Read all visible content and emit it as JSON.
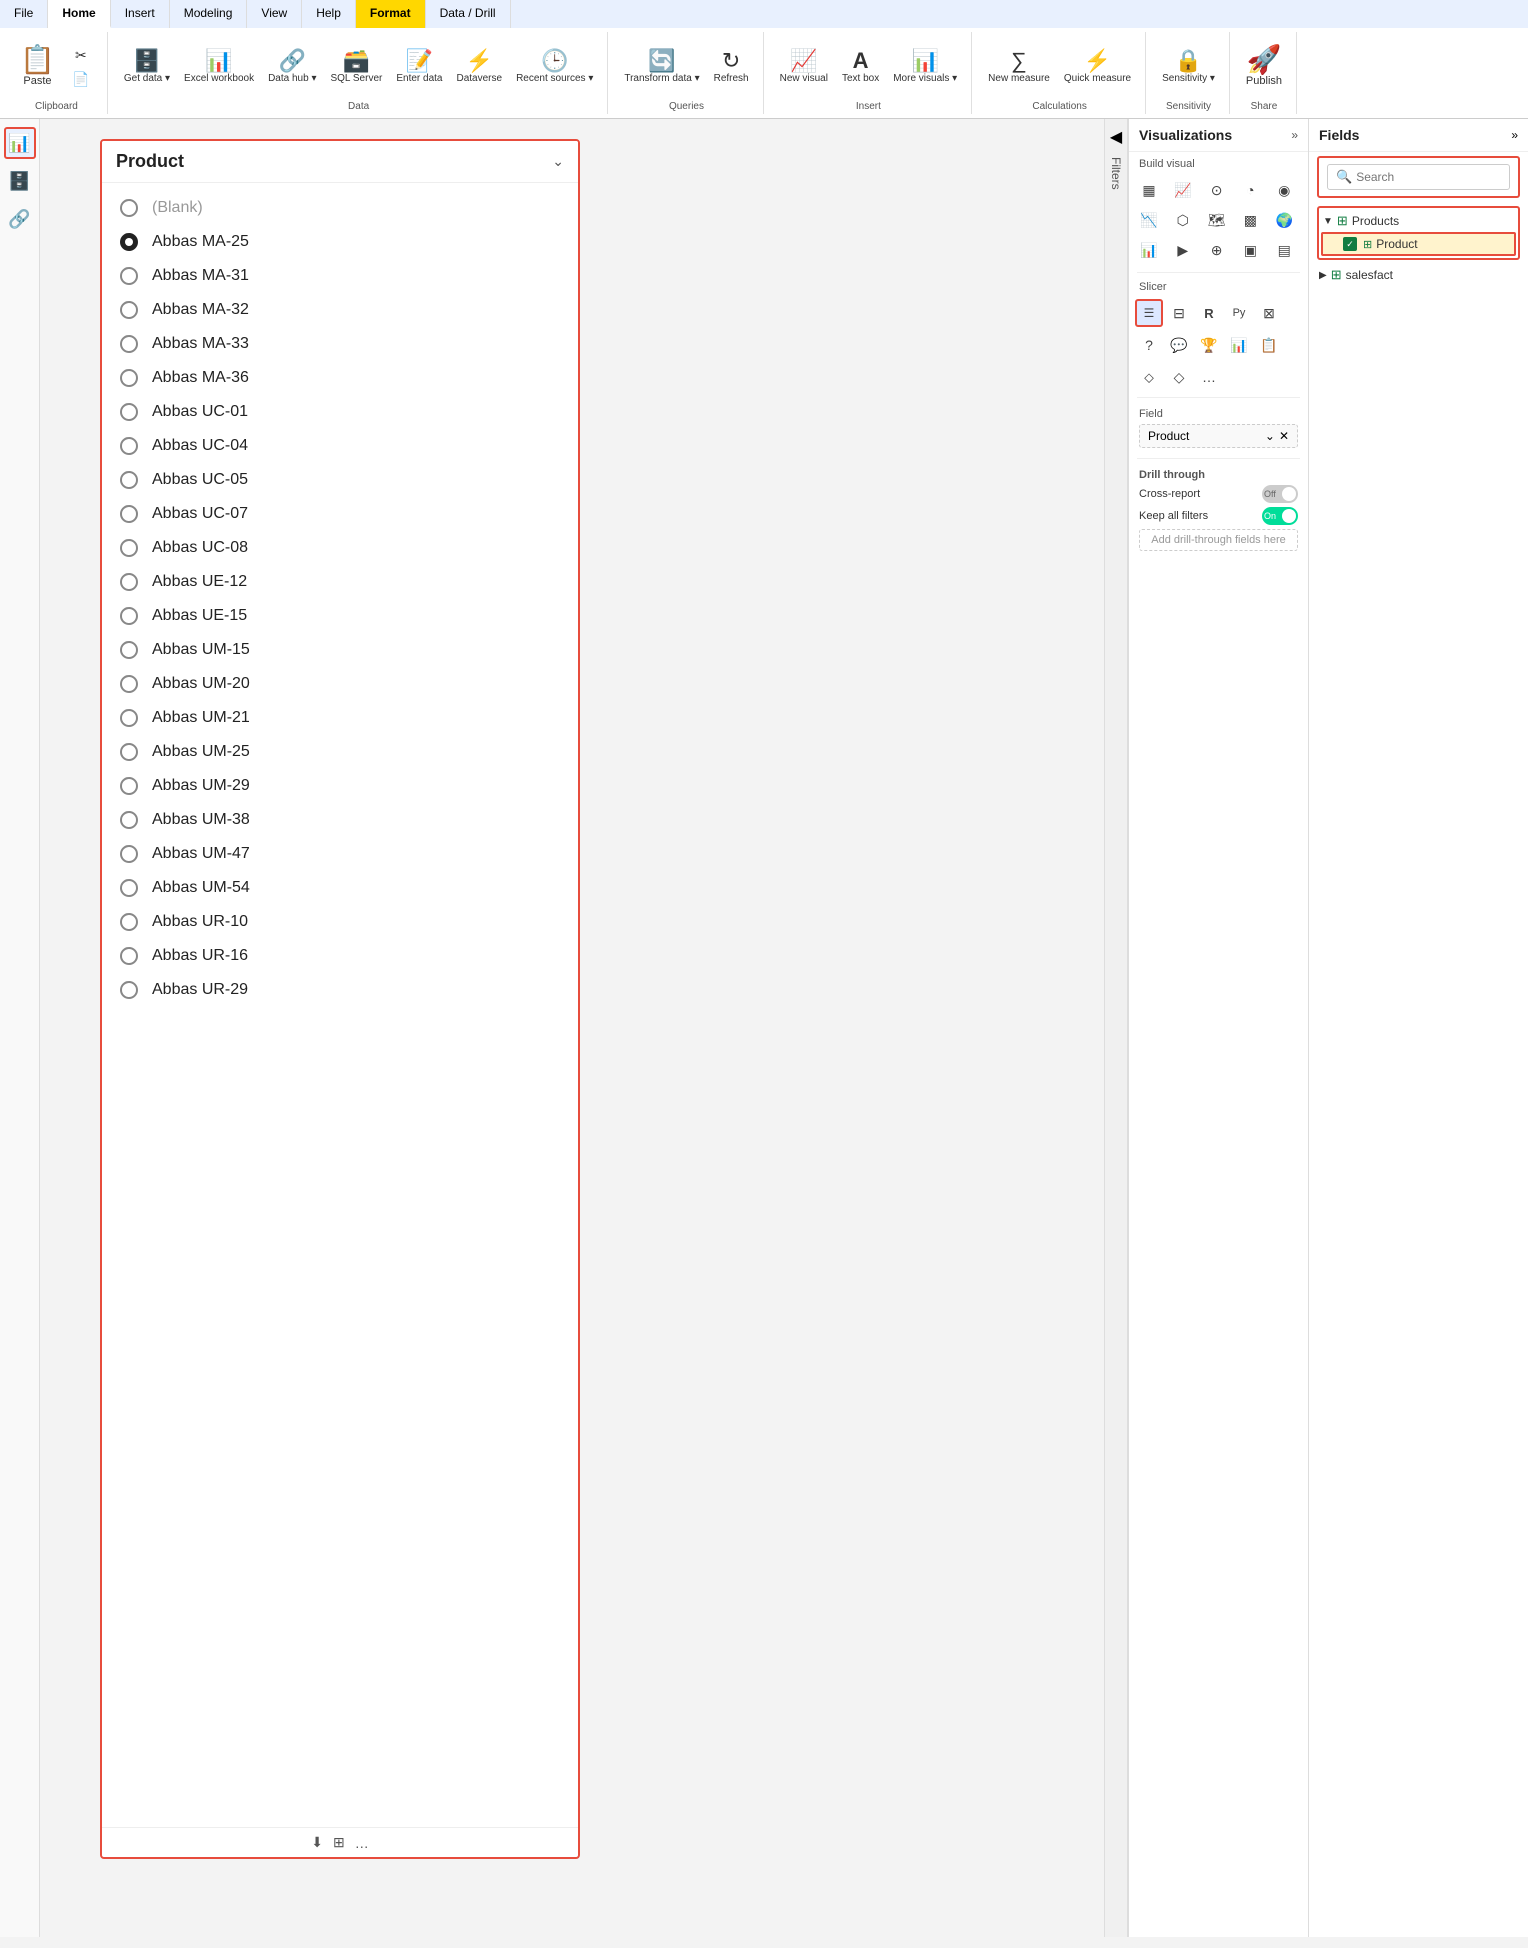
{
  "ribbon": {
    "tabs": [
      {
        "label": "File",
        "active": false
      },
      {
        "label": "Home",
        "active": true
      },
      {
        "label": "Insert",
        "active": false
      },
      {
        "label": "Modeling",
        "active": false
      },
      {
        "label": "View",
        "active": false
      },
      {
        "label": "Help",
        "active": false
      },
      {
        "label": "Format",
        "active": false,
        "highlight": true
      },
      {
        "label": "Data / Drill",
        "active": false
      }
    ],
    "groups": [
      {
        "name": "Clipboard",
        "buttons": [
          {
            "label": "Paste",
            "icon": "📋"
          },
          {
            "label": "",
            "icon": "✂️"
          },
          {
            "label": "",
            "icon": "📄"
          }
        ]
      },
      {
        "name": "Data",
        "buttons": [
          {
            "label": "Get data ▾",
            "icon": "🗄️"
          },
          {
            "label": "Excel workbook",
            "icon": "📊"
          },
          {
            "label": "Data hub ▾",
            "icon": "🔗"
          },
          {
            "label": "SQL Server",
            "icon": "🗃️"
          },
          {
            "label": "Enter data",
            "icon": "📝"
          },
          {
            "label": "Dataverse",
            "icon": "⚡"
          },
          {
            "label": "Recent sources ▾",
            "icon": "🕒"
          }
        ]
      },
      {
        "name": "Queries",
        "buttons": [
          {
            "label": "Transform data ▾",
            "icon": "🔄"
          },
          {
            "label": "Refresh",
            "icon": "↻"
          }
        ]
      },
      {
        "name": "Insert",
        "buttons": [
          {
            "label": "New visual",
            "icon": "📈"
          },
          {
            "label": "Text box",
            "icon": "A"
          },
          {
            "label": "More visuals ▾",
            "icon": "📊"
          }
        ]
      },
      {
        "name": "Calculations",
        "buttons": [
          {
            "label": "New measure",
            "icon": "∑"
          },
          {
            "label": "Quick measure",
            "icon": "⚡"
          }
        ]
      },
      {
        "name": "Sensitivity",
        "buttons": [
          {
            "label": "Sensitivity ▾",
            "icon": "🔒"
          }
        ]
      },
      {
        "name": "Share",
        "buttons": [
          {
            "label": "Publish",
            "icon": "🚀"
          }
        ]
      }
    ]
  },
  "left_sidebar": {
    "icons": [
      {
        "name": "report-icon",
        "symbol": "📊",
        "active": true
      },
      {
        "name": "data-icon",
        "symbol": "🗄️",
        "active": false
      },
      {
        "name": "model-icon",
        "symbol": "🔗",
        "active": false
      }
    ]
  },
  "slicer": {
    "title": "Product",
    "items": [
      {
        "label": "(Blank)",
        "selected": false,
        "blank": true
      },
      {
        "label": "Abbas MA-25",
        "selected": true
      },
      {
        "label": "Abbas MA-31",
        "selected": false
      },
      {
        "label": "Abbas MA-32",
        "selected": false
      },
      {
        "label": "Abbas MA-33",
        "selected": false
      },
      {
        "label": "Abbas MA-36",
        "selected": false
      },
      {
        "label": "Abbas UC-01",
        "selected": false
      },
      {
        "label": "Abbas UC-04",
        "selected": false
      },
      {
        "label": "Abbas UC-05",
        "selected": false
      },
      {
        "label": "Abbas UC-07",
        "selected": false
      },
      {
        "label": "Abbas UC-08",
        "selected": false
      },
      {
        "label": "Abbas UE-12",
        "selected": false
      },
      {
        "label": "Abbas UE-15",
        "selected": false
      },
      {
        "label": "Abbas UM-15",
        "selected": false
      },
      {
        "label": "Abbas UM-20",
        "selected": false
      },
      {
        "label": "Abbas UM-21",
        "selected": false
      },
      {
        "label": "Abbas UM-25",
        "selected": false
      },
      {
        "label": "Abbas UM-29",
        "selected": false
      },
      {
        "label": "Abbas UM-38",
        "selected": false
      },
      {
        "label": "Abbas UM-47",
        "selected": false
      },
      {
        "label": "Abbas UM-54",
        "selected": false
      },
      {
        "label": "Abbas UR-10",
        "selected": false
      },
      {
        "label": "Abbas UR-16",
        "selected": false
      },
      {
        "label": "Abbas UR-29",
        "selected": false
      }
    ],
    "bottom_icons": [
      "🔽",
      "⊞",
      "…"
    ]
  },
  "filters": {
    "label": "Filters"
  },
  "visualizations": {
    "title": "Visualizations",
    "build_visual_label": "Build visual",
    "slicer_label": "Slicer",
    "field_label": "Field",
    "field_value": "Product",
    "drill_through": {
      "title": "Drill through",
      "cross_report": {
        "label": "Cross-report",
        "state": "off"
      },
      "keep_all_filters": {
        "label": "Keep all filters",
        "state": "on"
      },
      "add_label": "Add drill-through fields here"
    }
  },
  "fields": {
    "title": "Fields",
    "search_placeholder": "Search",
    "groups": [
      {
        "name": "Products",
        "expanded": true,
        "icon": "table",
        "items": [
          {
            "name": "Product",
            "checked": true,
            "highlighted": true
          }
        ]
      },
      {
        "name": "salesfact",
        "expanded": false,
        "icon": "table",
        "items": []
      }
    ]
  }
}
